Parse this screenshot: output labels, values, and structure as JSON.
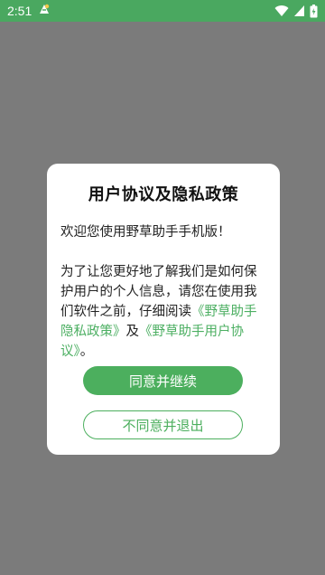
{
  "status_bar": {
    "time": "2:51",
    "colors": {
      "background": "#4aa860",
      "text": "#ffffff"
    },
    "icons": [
      "notification-app-icon",
      "wifi-icon",
      "cellular-signal-icon",
      "battery-icon"
    ]
  },
  "dialog": {
    "title": "用户协议及隐私政策",
    "welcome": "欢迎您使用野草助手手机版！",
    "body_prefix": "为了让您更好地了解我们是如何保护用户的个人信息，请您在使用我们软件之前，仔细阅读",
    "privacy_link": "《野草助手隐私政策》",
    "conjunction": "及",
    "agreement_link": "《野草助手用户协议》",
    "body_suffix": "。",
    "agree_button": "同意并继续",
    "disagree_button": "不同意并退出"
  },
  "colors": {
    "accent": "#4caf5e",
    "overlay": "#7b7b7b",
    "dialog_background": "#ffffff"
  }
}
